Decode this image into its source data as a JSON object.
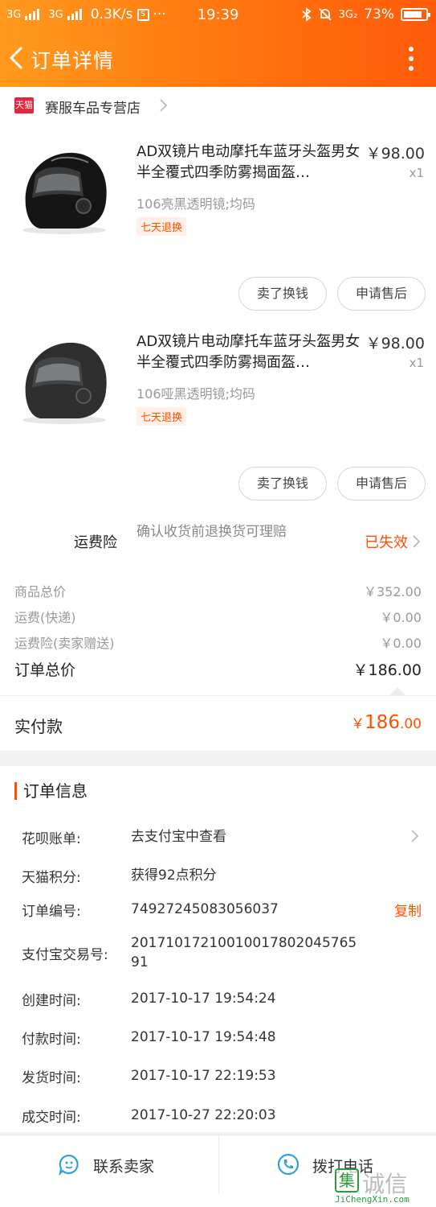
{
  "statusbar": {
    "net1": "3G",
    "net2": "3G",
    "speed": "0.3K/s",
    "dots": "···",
    "time": "19:39",
    "net3": "3G₂",
    "battery": "73%"
  },
  "nav": {
    "title": "订单详情"
  },
  "store": {
    "badge": "天猫",
    "name": "赛服车品专营店"
  },
  "products": [
    {
      "title": "AD双镜片电动摩托车蓝牙头盔男女半全覆式四季防雾揭面盔…",
      "price": "￥98.00",
      "qty": "x1",
      "sku": "106亮黑透明镜;均码",
      "tag": "七天退换",
      "btn_sell": "卖了换钱",
      "btn_after": "申请售后",
      "color": "#151515"
    },
    {
      "title": "AD双镜片电动摩托车蓝牙头盔男女半全覆式四季防雾揭面盔…",
      "price": "￥98.00",
      "qty": "x1",
      "sku": "106哑黑透明镜;均码",
      "tag": "七天退换",
      "btn_sell": "卖了换钱",
      "btn_after": "申请售后",
      "color": "#2e2e2e"
    }
  ],
  "insurance": {
    "label": "运费险",
    "desc": "确认收货前退换货可理赔",
    "status": "已失效"
  },
  "costs": {
    "goods_label": "商品总价",
    "goods_value": "￥352.00",
    "ship_label": "运费(快递)",
    "ship_value": "￥0.00",
    "ins_label": "运费险(卖家赠送)",
    "ins_value": "￥0.00",
    "total_label": "订单总价",
    "total_value": "￥186.00"
  },
  "paid": {
    "label": "实付款",
    "currency": "￥",
    "integer": "186",
    "decimal": ".00"
  },
  "order_info": {
    "title": "订单信息",
    "huabei_label": "花呗账单:",
    "huabei_value": "去支付宝中查看",
    "points_label": "天猫积分:",
    "points_value": "获得92点积分",
    "order_no_label": "订单编号:",
    "order_no_value": "74927245083056037",
    "copy_label": "复制",
    "alipay_label": "支付宝交易号:",
    "alipay_value": "2017101721001001780204576591",
    "created_label": "创建时间:",
    "created_value": "2017-10-17 19:54:24",
    "paid_label": "付款时间:",
    "paid_value": "2017-10-17 19:54:48",
    "shipped_label": "发货时间:",
    "shipped_value": "2017-10-17 22:19:53",
    "closed_label": "成交时间:",
    "closed_value": "2017-10-27 22:20:03"
  },
  "bottom": {
    "contact_label": "联系卖家",
    "call_label": "拨打电话"
  },
  "watermark": {
    "char": "集",
    "text": "诚信",
    "url": "JiChengXin.com"
  },
  "colors": {
    "accent": "#ff5000",
    "header_start": "#ff9a1e",
    "header_end": "#ff5a0a",
    "tmall": "#e6233a"
  }
}
